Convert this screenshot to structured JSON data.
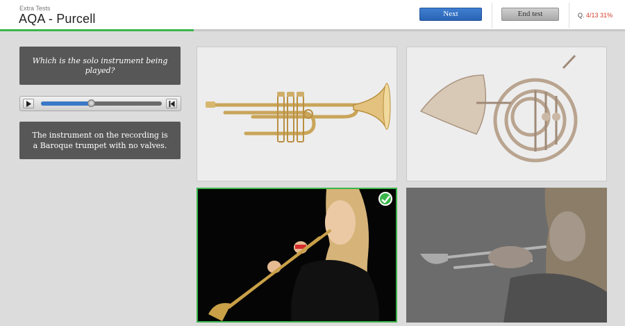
{
  "header": {
    "subtitle": "Extra Tests",
    "title": "AQA - Purcell",
    "next_label": "Next",
    "end_test_label": "End test",
    "question_prefix": "Q.",
    "question_number": "4/13",
    "percent": "31%",
    "progress_fraction": 0.31
  },
  "question": {
    "text": "Which is the solo instrument being played?"
  },
  "audio_player": {
    "position_fraction": 0.42
  },
  "feedback": {
    "text": "The instrument on the recording is a Baroque trumpet with no valves."
  },
  "answers": [
    {
      "icon": "modern-trumpet-image",
      "state": "default"
    },
    {
      "icon": "french-horn-image",
      "state": "default"
    },
    {
      "icon": "baroque-trumpet-player-image",
      "state": "correct"
    },
    {
      "icon": "trumpet-player-image",
      "state": "faded"
    }
  ],
  "colors": {
    "primary_button": "#2a64b4",
    "correct_green": "#3ab54a",
    "progress_green": "#3db54a",
    "counter_red": "#d23b2b",
    "panel_gray": "#575757"
  }
}
